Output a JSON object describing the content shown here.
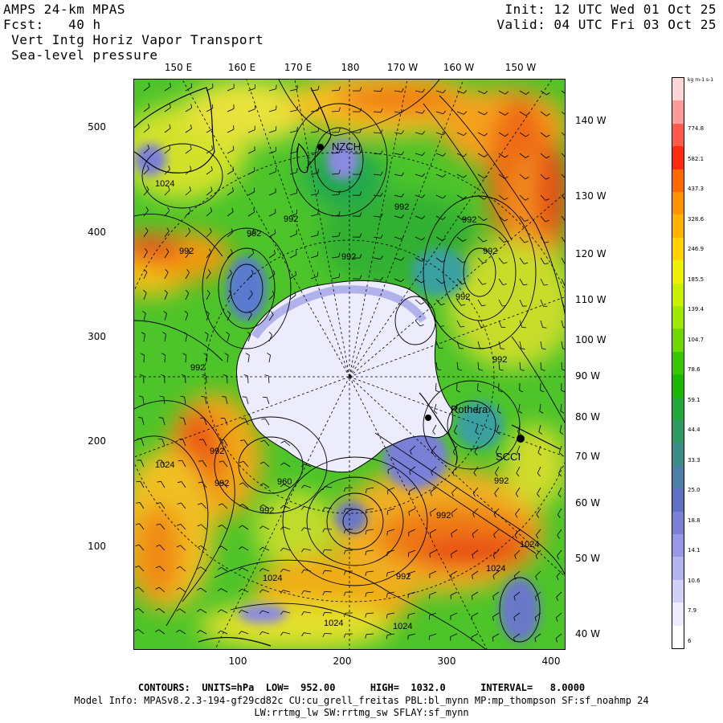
{
  "header": {
    "line1_left": "AMPS 24-km MPAS",
    "line2_left": "Fcst:   40 h",
    "line3_left": " Vert Intg Horiz Vapor Transport",
    "line4_left": " Sea-level pressure",
    "line1_right": "Init: 12 UTC Wed 01 Oct 25",
    "line2_right": "Valid: 04 UTC Fri 03 Oct 25"
  },
  "lon_labels_top": [
    "150 E",
    "160 E",
    "170 E",
    "180",
    "170 W",
    "160 W",
    "150 W"
  ],
  "lat_labels_right": [
    "140 W",
    "130 W",
    "120 W",
    "110 W",
    "100 W",
    "90 W",
    "80 W",
    "70 W",
    "60 W",
    "50 W",
    "40 W"
  ],
  "y_axis_ticks": [
    "500",
    "400",
    "300",
    "200",
    "100"
  ],
  "x_axis_ticks": [
    "100",
    "200",
    "300",
    "400"
  ],
  "contour_labels": [
    "1024",
    "992",
    "992",
    "992",
    "992",
    "992",
    "992",
    "992",
    "992",
    "992",
    "992",
    "1024",
    "992",
    "960",
    "992",
    "992",
    "992",
    "1024",
    "1024",
    "992",
    "1024",
    "1024",
    "1024",
    "992"
  ],
  "stations": [
    "NZCH",
    "Rothera",
    "SCCI"
  ],
  "colorbar": {
    "title": "kg m-1 s-1",
    "labels": [
      "774.8",
      "582.1",
      "437.3",
      "328.6",
      "246.9",
      "185.5",
      "139.4",
      "104.7",
      "78.6",
      "59.1",
      "44.4",
      "33.3",
      "25.0",
      "18.8",
      "14.1",
      "10.6",
      "7.9",
      "6"
    ],
    "colors": [
      "#ffd4d4",
      "#ff9b9b",
      "#ff5a4a",
      "#ff2a10",
      "#ff6a00",
      "#ff9400",
      "#ffb300",
      "#ffd200",
      "#f0f000",
      "#c8f000",
      "#a0e800",
      "#6ed800",
      "#38c800",
      "#18b800",
      "#20a838",
      "#2c9a60",
      "#3a8c88",
      "#4a80a8",
      "#6070c0",
      "#7a80d8",
      "#9898e8",
      "#b4b4f0",
      "#d0d0f8",
      "#ececfc",
      "#ffffff"
    ]
  },
  "footer": {
    "contours": "CONTOURS:  UNITS=hPa  LOW=  952.00      HIGH=  1032.0      INTERVAL=   8.0000",
    "model_info": "Model Info: MPASv8.2.3-194-gf29cd82c CU:cu_grell_freitas PBL:bl_mynn MP:mp_thompson SF:sf_noahmp 24",
    "model_info2": "LW:rrtmg_lw SW:rrtmg_sw SFLAY:sf_mynn"
  }
}
